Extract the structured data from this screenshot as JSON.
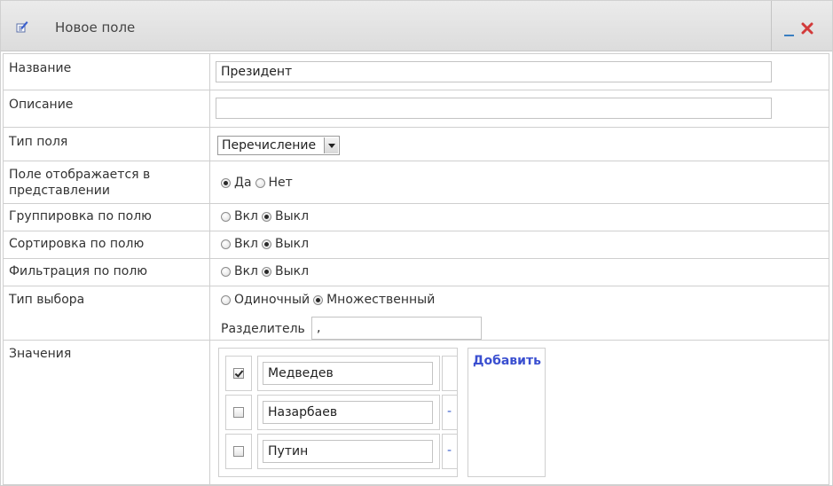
{
  "window": {
    "title": "Новое поле",
    "accent_color": "#3a7fc1",
    "close_color": "#d23a3a"
  },
  "fields": {
    "name": {
      "label": "Название",
      "value": "Президент"
    },
    "description": {
      "label": "Описание",
      "value": ""
    },
    "field_type": {
      "label": "Тип поля",
      "selected": "Перечисление"
    },
    "visible_in_view": {
      "label": "Поле отображается в представлении",
      "options": [
        "Да",
        "Нет"
      ],
      "selected": "Да"
    },
    "group_by": {
      "label": "Группировка по полю",
      "options": [
        "Вкл",
        "Выкл"
      ],
      "selected": "Выкл"
    },
    "sort_by": {
      "label": "Сортировка по полю",
      "options": [
        "Вкл",
        "Выкл"
      ],
      "selected": "Выкл"
    },
    "filter_by": {
      "label": "Фильтрация по полю",
      "options": [
        "Вкл",
        "Выкл"
      ],
      "selected": "Выкл"
    },
    "selection_type": {
      "label": "Тип выбора",
      "options": [
        "Одиночный",
        "Множественный"
      ],
      "selected": "Множественный",
      "delimiter_label": "Разделитель",
      "delimiter_value": ","
    },
    "values": {
      "label": "Значения",
      "add_label": "Добавить",
      "items": [
        {
          "text": "Медведев",
          "checked": true,
          "remove_label": ""
        },
        {
          "text": "Назарбаев",
          "checked": false,
          "remove_label": "-"
        },
        {
          "text": "Путин",
          "checked": false,
          "remove_label": "-"
        }
      ]
    }
  }
}
